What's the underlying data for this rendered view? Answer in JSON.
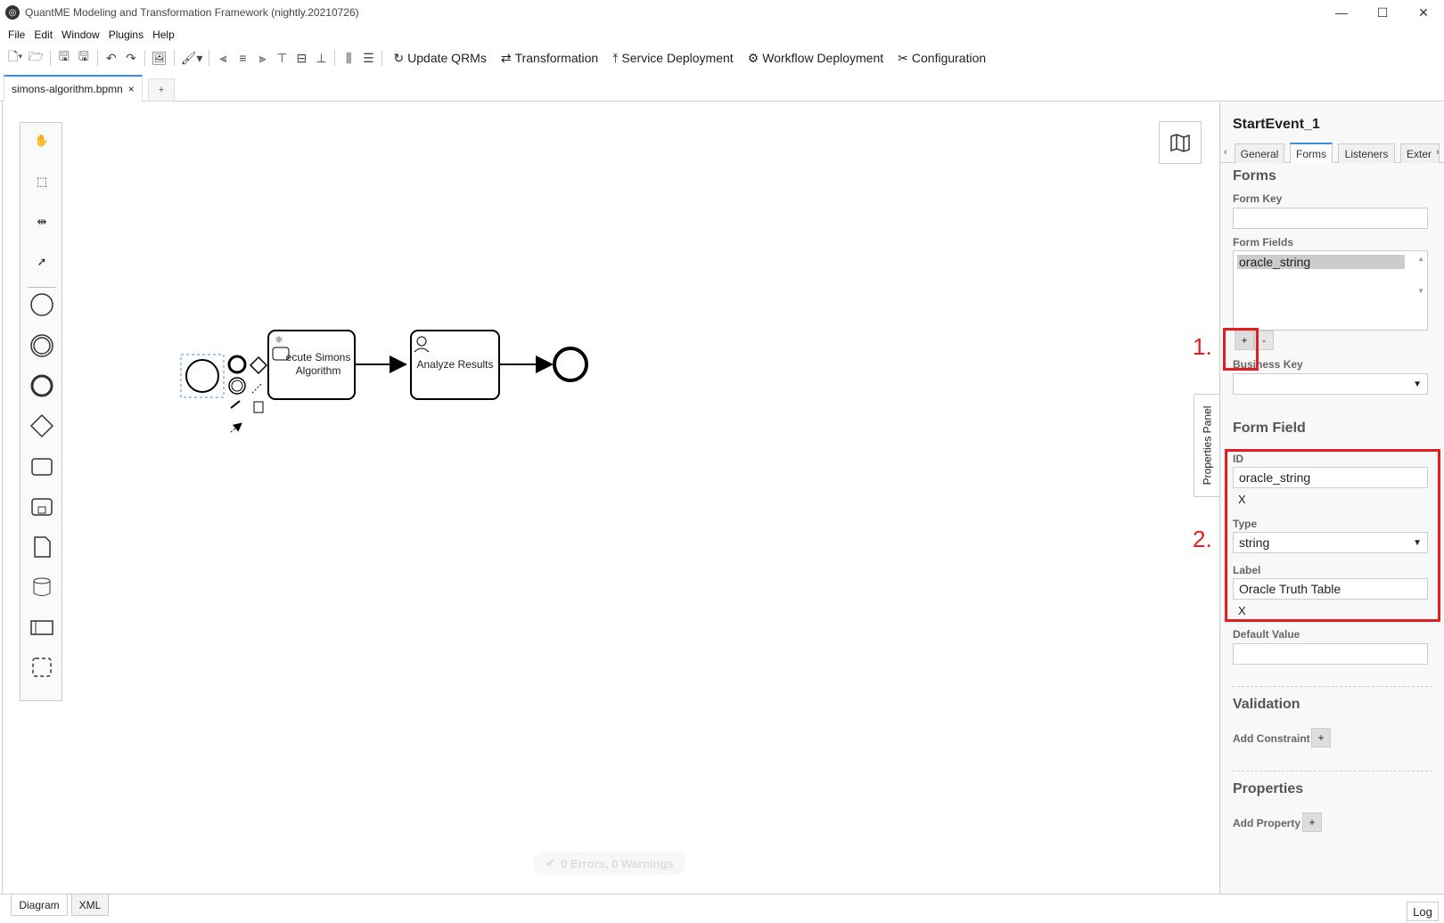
{
  "window": {
    "title": "QuantME Modeling and Transformation Framework (nightly.20210726)",
    "controls": [
      "minimize",
      "maximize",
      "close"
    ]
  },
  "menu": [
    "File",
    "Edit",
    "Window",
    "Plugins",
    "Help"
  ],
  "toolbar": {
    "actions": [
      {
        "label": "Update QRMs",
        "icon": "refresh-icon"
      },
      {
        "label": "Transformation",
        "icon": "transform-icon"
      },
      {
        "label": "Service Deployment",
        "icon": "upload-icon"
      },
      {
        "label": "Workflow Deployment",
        "icon": "gear-icon"
      },
      {
        "label": "Configuration",
        "icon": "tools-icon"
      }
    ]
  },
  "tabs": {
    "file_tab": "simons-algorithm.bpmn",
    "close": "×",
    "add": "+"
  },
  "diagram": {
    "task1_label": "Execute Simons Algorithm",
    "task1_visible": "ecute Simons\nAlgorithm",
    "task2_label": "Analyze Results"
  },
  "status": {
    "text": "0 Errors, 0 Warnings"
  },
  "properties_handle": "Properties Panel",
  "panel": {
    "element_id": "StartEvent_1",
    "tabs": [
      "General",
      "Forms",
      "Listeners",
      "Exter"
    ],
    "active_tab": "Forms",
    "forms_heading": "Forms",
    "form_key_label": "Form Key",
    "form_key_value": "",
    "form_fields_label": "Form Fields",
    "form_fields": [
      "oracle_string"
    ],
    "add_btn": "+",
    "remove_btn": "-",
    "business_key_label": "Business Key",
    "business_key_value": "",
    "form_field_heading": "Form Field",
    "id_label": "ID",
    "id_value": "oracle_string",
    "clear": "X",
    "type_label": "Type",
    "type_value": "string",
    "label_label": "Label",
    "label_value": "Oracle Truth Table",
    "default_label": "Default Value",
    "default_value": "",
    "validation_heading": "Validation",
    "add_constraint": "Add Constraint",
    "properties_heading": "Properties",
    "add_property": "Add Property"
  },
  "annotations": {
    "n1": "1.",
    "n2": "2.",
    "color": "#e02020"
  },
  "bottom": {
    "tabs": [
      "Diagram",
      "XML"
    ],
    "log": "Log"
  }
}
